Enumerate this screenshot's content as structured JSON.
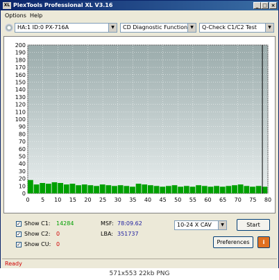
{
  "window": {
    "title": "PlexTools Professional XL V3.16",
    "app_icon": "XL",
    "minimize": "_",
    "maximize": "□",
    "close": "×"
  },
  "menu": [
    "Options",
    "Help"
  ],
  "toolbar": {
    "drive": "HA:1 ID:0  PX-716A",
    "function": "CD Diagnostic Functions",
    "test": "Q-Check C1/C2 Test"
  },
  "chart_data": {
    "type": "bar",
    "title": "",
    "xlabel": "",
    "ylabel": "",
    "xlim": [
      0,
      80
    ],
    "ylim": [
      0,
      200
    ],
    "x_ticks": [
      0,
      5,
      10,
      15,
      20,
      25,
      30,
      35,
      40,
      45,
      50,
      55,
      60,
      65,
      70,
      75,
      80
    ],
    "y_ticks": [
      0,
      10,
      20,
      30,
      40,
      50,
      60,
      70,
      80,
      90,
      100,
      110,
      120,
      130,
      140,
      150,
      160,
      170,
      180,
      190,
      200
    ],
    "grid": true,
    "end_of_disc_marker": 78.16,
    "series": [
      {
        "name": "C1",
        "color": "#00a000",
        "x": [
          0,
          2,
          4,
          6,
          8,
          10,
          12,
          14,
          16,
          18,
          20,
          22,
          24,
          26,
          28,
          30,
          32,
          34,
          36,
          38,
          40,
          42,
          44,
          46,
          48,
          50,
          52,
          54,
          56,
          58,
          60,
          62,
          64,
          66,
          68,
          70,
          72,
          74,
          76,
          78
        ],
        "values": [
          18,
          12,
          14,
          13,
          15,
          14,
          12,
          13,
          11,
          12,
          11,
          10,
          12,
          11,
          10,
          11,
          10,
          9,
          13,
          12,
          11,
          10,
          9,
          10,
          11,
          9,
          10,
          9,
          11,
          10,
          9,
          10,
          9,
          10,
          11,
          12,
          10,
          9,
          10,
          9
        ]
      }
    ]
  },
  "stats": {
    "c1_label": "Show C1:",
    "c1_value": "14284",
    "c2_label": "Show C2:",
    "c2_value": "0",
    "cu_label": "Show CU:",
    "cu_value": "0",
    "msf_label": "MSF:",
    "msf_value": "78:09.62",
    "lba_label": "LBA:",
    "lba_value": "351737"
  },
  "speed": "10-24 X CAV",
  "buttons": {
    "start": "Start",
    "preferences": "Preferences",
    "info": "i"
  },
  "status": "Ready",
  "caption": "571x553 22kb PNG",
  "colors": {
    "title_bar": "#0a246a",
    "plot_background": "#b8c4c4",
    "c1_series": "#00a000",
    "c1_value": "#00a000",
    "c2_value": "#d00000",
    "cu_value": "#d00000",
    "msf_value": "#2020a0",
    "status_text": "#d00000"
  }
}
